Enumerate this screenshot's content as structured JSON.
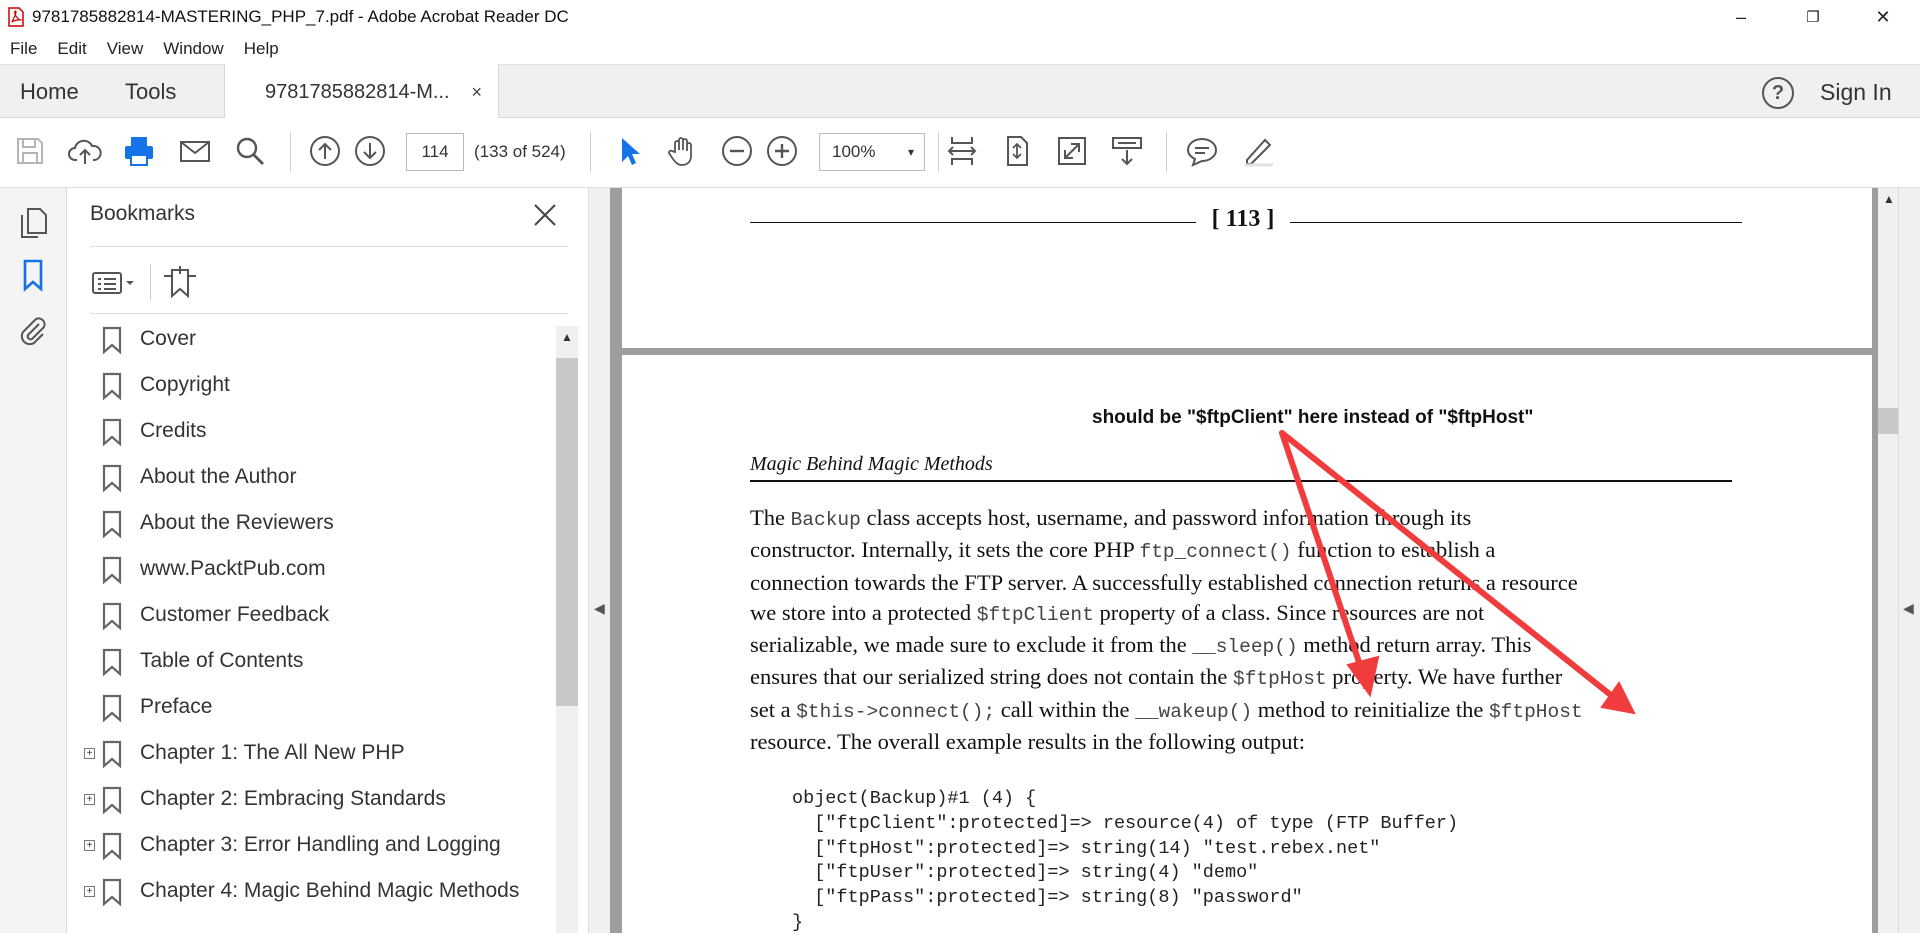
{
  "window": {
    "title": "9781785882814-MASTERING_PHP_7.pdf - Adobe Acrobat Reader DC",
    "controls": {
      "minimize": "–",
      "restore": "❐",
      "close": "✕"
    }
  },
  "menu": [
    "File",
    "Edit",
    "View",
    "Window",
    "Help"
  ],
  "tabs": {
    "home": "Home",
    "tools": "Tools",
    "document": "9781785882814-M...",
    "document_close": "×",
    "help": "?",
    "sign_in": "Sign In"
  },
  "toolbar": {
    "page_input": "114",
    "page_count": "(133 of 524)",
    "zoom": "100%",
    "zoom_caret": "▾",
    "accent": "#1473e6"
  },
  "bookmarks": {
    "title": "Bookmarks",
    "items": [
      {
        "label": "Cover",
        "expandable": false
      },
      {
        "label": "Copyright",
        "expandable": false
      },
      {
        "label": "Credits",
        "expandable": false
      },
      {
        "label": "About the Author",
        "expandable": false
      },
      {
        "label": "About the Reviewers",
        "expandable": false
      },
      {
        "label": "www.PacktPub.com",
        "expandable": false
      },
      {
        "label": "Customer Feedback",
        "expandable": false
      },
      {
        "label": "Table of Contents",
        "expandable": false
      },
      {
        "label": "Preface",
        "expandable": false
      },
      {
        "label": "Chapter 1: The All New PHP",
        "expandable": true
      },
      {
        "label": "Chapter 2: Embracing Standards",
        "expandable": true
      },
      {
        "label": "Chapter 3: Error Handling and Logging",
        "expandable": true
      },
      {
        "label": "Chapter 4: Magic Behind Magic Methods",
        "expandable": true
      }
    ]
  },
  "document": {
    "page_number": "[ 113 ]",
    "annotation": "should be \"$ftpClient\" here instead of \"$ftpHost\"",
    "annotation_arrow_color": "#f03c3c",
    "running_header": "Magic Behind Magic Methods",
    "paragraph_lines": [
      [
        "The ",
        "Backup",
        " class accepts host, username, and password information through its"
      ],
      [
        "constructor. Internally, it sets the core PHP ",
        "ftp_connect()",
        " function to establish a"
      ],
      [
        "connection towards the FTP server. A successfully established connection returns a resource"
      ],
      [
        "we store into a protected ",
        "$ftpClient",
        " property of a class. Since resources are not"
      ],
      [
        "serializable, we made sure to exclude it from the ",
        "__sleep()",
        " method return array. This"
      ],
      [
        "ensures that our serialized string does not contain the ",
        "$ftpHost",
        " property. We have further"
      ],
      [
        "set a ",
        "$this->connect();",
        " call within the ",
        "__wakeup()",
        " method to reinitialize the ",
        "$ftpHost"
      ],
      [
        "resource. The overall example results in the following output:"
      ]
    ],
    "code": [
      "object(Backup)#1 (4) {",
      "  [\"ftpClient\":protected]=> resource(4) of type (FTP Buffer)",
      "  [\"ftpHost\":protected]=> string(14) \"test.rebex.net\"",
      "  [\"ftpUser\":protected]=> string(4) \"demo\"",
      "  [\"ftpPass\":protected]=> string(8) \"password\"",
      "}"
    ]
  }
}
